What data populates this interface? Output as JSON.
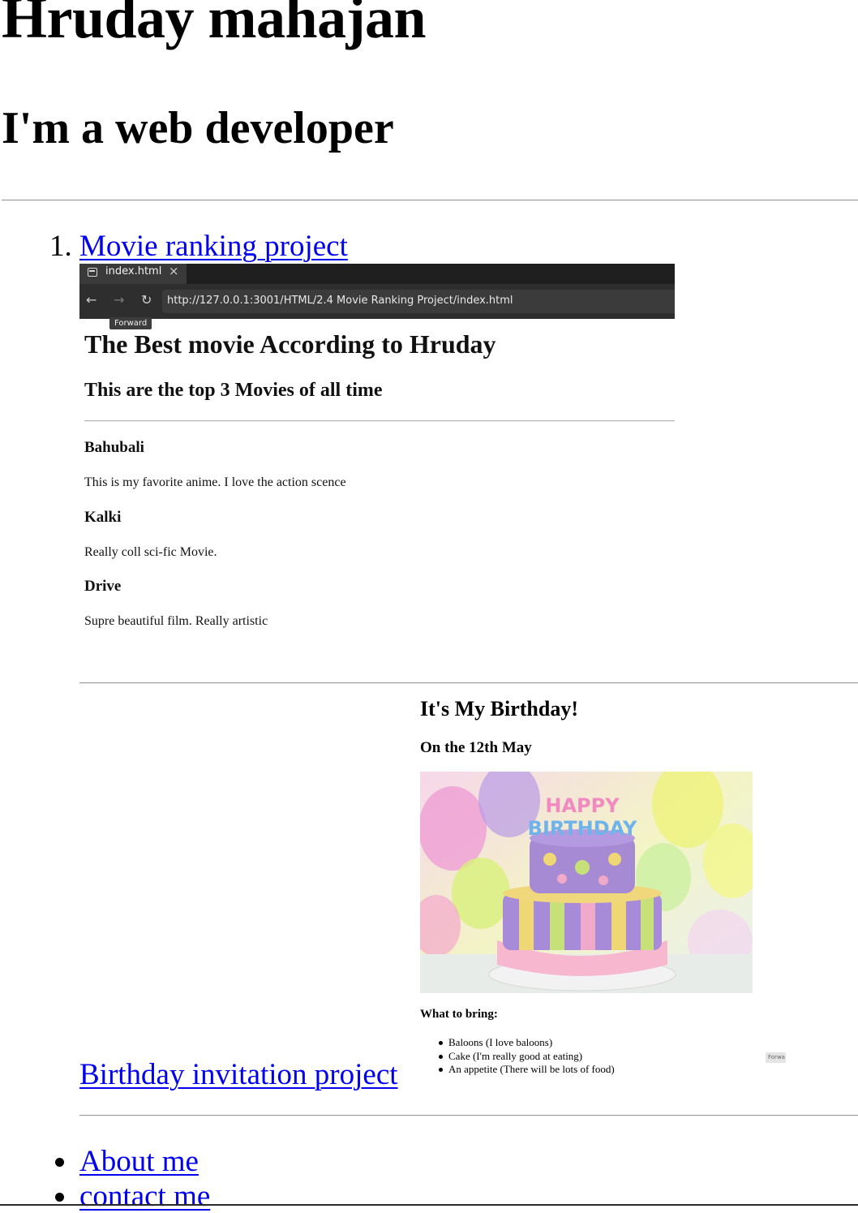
{
  "header": {
    "name": "Hruday mahajan",
    "tagline": "I'm a web developer"
  },
  "projects": {
    "list_number_1": "1.",
    "items": [
      {
        "label": "Movie ranking project"
      },
      {
        "label": "Birthday invitation project"
      }
    ]
  },
  "movie_screenshot": {
    "tab_title": "index.html",
    "tab_close_glyph": "×",
    "nav_back_glyph": "←",
    "nav_forward_glyph": "→",
    "nav_reload_glyph": "↻",
    "url": "http://127.0.0.1:3001/HTML/2.4 Movie Ranking Project/index.html",
    "tooltip": "Forward",
    "title": "The Best movie According to Hruday",
    "subtitle": "This are the top 3 Movies of all time",
    "movies": [
      {
        "name": "Bahubali",
        "desc": "This is my favorite anime. I love the action scence"
      },
      {
        "name": "Kalki",
        "desc": "Really coll sci-fic Movie."
      },
      {
        "name": "Drive",
        "desc": "Supre beautiful film. Really artistic"
      }
    ]
  },
  "birthday_screenshot": {
    "title": "It's My Birthday!",
    "subtitle": "On the 12th May",
    "image_icon": "birthday-cake-image",
    "bring_heading": "What to bring:",
    "bring_items": [
      "Baloons (I love baloons)",
      "Cake (I'm really good at eating)",
      "An appetite (There will be lots of food)"
    ],
    "mini_tooltip": "Forwa"
  },
  "links": {
    "about": "About me",
    "contact": "contact me"
  },
  "colors": {
    "link": "#0000ee",
    "browser_chrome": "#1f1f1f"
  }
}
